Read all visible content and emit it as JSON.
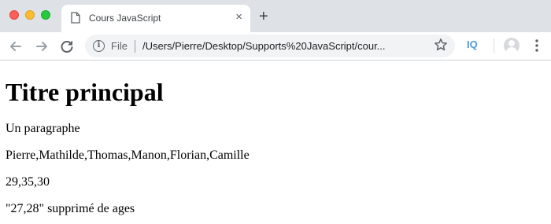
{
  "browser": {
    "tab": {
      "title": "Cours JavaScript",
      "close_glyph": "×"
    },
    "new_tab_glyph": "+",
    "omnibox": {
      "scheme_label": "File",
      "url": "/Users/Pierre/Desktop/Supports%20JavaScript/cour..."
    },
    "extension_label": "IQ",
    "icons": [
      "back-arrow-icon",
      "forward-arrow-icon",
      "reload-icon",
      "info-icon",
      "star-icon",
      "user-avatar-icon",
      "more-menu-icon",
      "page-icon"
    ]
  },
  "page": {
    "heading": "Titre principal",
    "paragraphs": [
      "Un paragraphe",
      "Pierre,Mathilde,Thomas,Manon,Florian,Camille",
      "29,35,30",
      "\"27,28\" supprimé de ages"
    ]
  },
  "colors": {
    "tabstrip_bg": "#dee1e6",
    "close_red": "#fe5f57",
    "minimize_yellow": "#febc2e",
    "zoom_green": "#28c840",
    "extension_blue": "#4a9bd6"
  }
}
